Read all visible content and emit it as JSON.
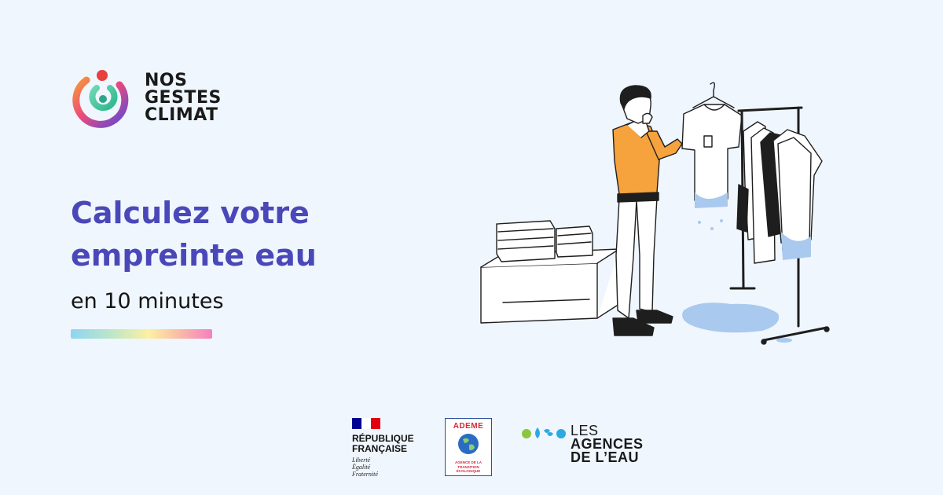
{
  "brand": {
    "lines": [
      "NOS",
      "GESTES",
      "CLIMAT"
    ],
    "icon": "nos-gestes-climat-logo-icon"
  },
  "headline": {
    "line1": "Calculez votre",
    "line2": "empreinte eau",
    "subline": "en 10 minutes"
  },
  "illustration": {
    "icon": "man-choosing-clothes-illustration"
  },
  "partners": {
    "rf": {
      "title1": "RÉPUBLIQUE",
      "title2": "FRANÇAISE",
      "motto": [
        "Liberté",
        "Égalité",
        "Fraternité"
      ]
    },
    "ademe": {
      "name": "ADEME",
      "sub": [
        "AGENCE DE LA",
        "TRANSITION",
        "ÉCOLOGIQUE"
      ]
    },
    "agences": {
      "line1": "LES",
      "line2": "AGENCES",
      "line3": "DE L’EAU"
    }
  },
  "colors": {
    "background": "#eff6fd",
    "headline": "#4a48b8",
    "shirt": "#f6a23d",
    "water": "#a9c9ee"
  }
}
